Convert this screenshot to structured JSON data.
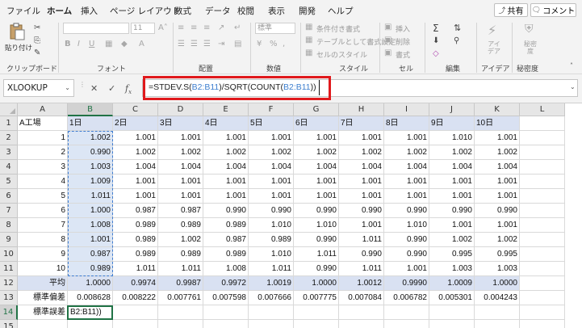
{
  "menu": {
    "tabs": [
      "ファイル",
      "ホーム",
      "挿入",
      "ページ レイアウト",
      "数式",
      "データ",
      "校閲",
      "表示",
      "開発",
      "ヘルプ"
    ],
    "active": "ホーム",
    "share_label": "共有",
    "comment_label": "コメント"
  },
  "ribbon": {
    "groups": [
      "クリップボード",
      "フォント",
      "配置",
      "数値",
      "スタイル",
      "セル",
      "編集",
      "アイデア",
      "秘密度"
    ],
    "paste_label": "貼り付け",
    "font_size": "11",
    "number_format": "標準",
    "cond_format": "条件付き書式",
    "table_format": "テーブルとして書式設定",
    "cell_styles": "セルのスタイル",
    "insert": "挿入",
    "delete": "削除",
    "format": "書式",
    "ideas": "アイ デア",
    "sensitivity": "秘密 度"
  },
  "formula_bar": {
    "name_box": "XLOOKUP",
    "formula_parts": [
      "=STDEV.S(",
      "B2:B11",
      ")/SQRT(COUNT(",
      "B2:B11",
      "))"
    ]
  },
  "sheet": {
    "columns": [
      "A",
      "B",
      "C",
      "D",
      "E",
      "F",
      "G",
      "H",
      "I",
      "J",
      "K",
      "L"
    ],
    "selected_column": "B",
    "selected_row": "14",
    "rows": [
      {
        "n": "1",
        "cells": [
          "A工場",
          "1日",
          "2日",
          "3日",
          "4日",
          "5日",
          "6日",
          "7日",
          "8日",
          "9日",
          "10日",
          ""
        ]
      },
      {
        "n": "2",
        "cells": [
          "1",
          "1.002",
          "1.001",
          "1.001",
          "1.001",
          "1.001",
          "1.001",
          "1.001",
          "1.001",
          "1.010",
          "1.001",
          ""
        ]
      },
      {
        "n": "3",
        "cells": [
          "2",
          "0.990",
          "1.002",
          "1.002",
          "1.002",
          "1.002",
          "1.002",
          "1.002",
          "1.002",
          "1.002",
          "1.002",
          ""
        ]
      },
      {
        "n": "4",
        "cells": [
          "3",
          "1.003",
          "1.004",
          "1.004",
          "1.004",
          "1.004",
          "1.004",
          "1.004",
          "1.004",
          "1.004",
          "1.004",
          ""
        ]
      },
      {
        "n": "5",
        "cells": [
          "4",
          "1.009",
          "1.001",
          "1.001",
          "1.001",
          "1.001",
          "1.001",
          "1.001",
          "1.001",
          "1.001",
          "1.001",
          ""
        ]
      },
      {
        "n": "6",
        "cells": [
          "5",
          "1.011",
          "1.001",
          "1.001",
          "1.001",
          "1.001",
          "1.001",
          "1.001",
          "1.001",
          "1.001",
          "1.001",
          ""
        ]
      },
      {
        "n": "7",
        "cells": [
          "6",
          "1.000",
          "0.987",
          "0.987",
          "0.990",
          "0.990",
          "0.990",
          "0.990",
          "0.990",
          "0.990",
          "0.990",
          ""
        ]
      },
      {
        "n": "8",
        "cells": [
          "7",
          "1.008",
          "0.989",
          "0.989",
          "0.989",
          "1.010",
          "1.010",
          "1.001",
          "1.010",
          "1.001",
          "1.001",
          ""
        ]
      },
      {
        "n": "9",
        "cells": [
          "8",
          "1.001",
          "0.989",
          "1.002",
          "0.987",
          "0.989",
          "0.990",
          "1.011",
          "0.990",
          "1.002",
          "1.002",
          ""
        ]
      },
      {
        "n": "10",
        "cells": [
          "9",
          "0.987",
          "0.989",
          "0.989",
          "0.989",
          "1.010",
          "1.011",
          "0.990",
          "0.990",
          "0.995",
          "0.995",
          ""
        ]
      },
      {
        "n": "11",
        "cells": [
          "10",
          "0.989",
          "1.011",
          "1.011",
          "1.008",
          "1.011",
          "0.990",
          "1.011",
          "1.001",
          "1.003",
          "1.003",
          ""
        ]
      },
      {
        "n": "12",
        "cells": [
          "平均",
          "1.0000",
          "0.9974",
          "0.9987",
          "0.9972",
          "1.0019",
          "1.0000",
          "1.0012",
          "0.9990",
          "1.0009",
          "1.0000",
          ""
        ]
      },
      {
        "n": "13",
        "cells": [
          "標準偏差",
          "0.008628",
          "0.008222",
          "0.007761",
          "0.007598",
          "0.007666",
          "0.007775",
          "0.007084",
          "0.006782",
          "0.005301",
          "0.004243",
          ""
        ]
      },
      {
        "n": "14",
        "cells": [
          "標準誤差",
          "B2:B11))",
          "",
          "",
          "",
          "",
          "",
          "",
          "",
          "",
          "",
          ""
        ]
      },
      {
        "n": "15",
        "cells": [
          "",
          "",
          "",
          "",
          "",
          "",
          "",
          "",
          "",
          "",
          "",
          ""
        ]
      }
    ]
  }
}
